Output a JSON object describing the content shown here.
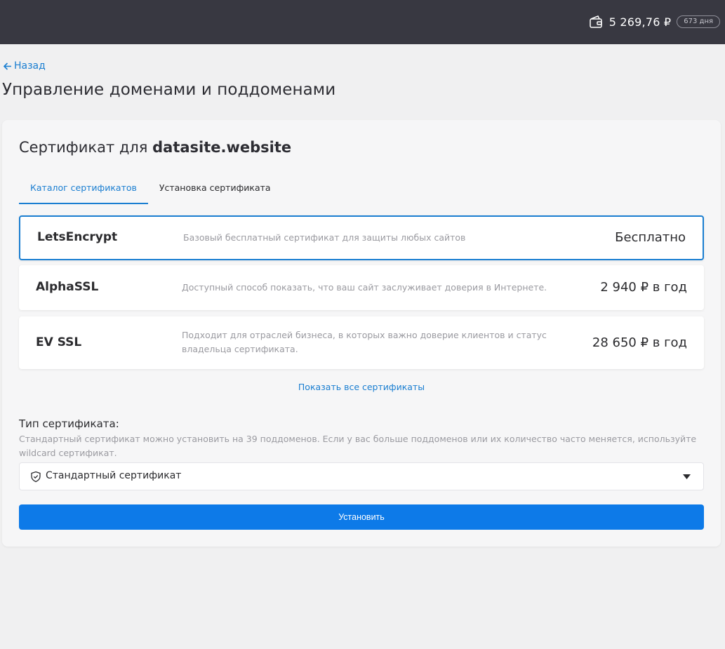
{
  "header": {
    "balance": "5 269,76 ₽",
    "days": "673 дня",
    "wallet_icon": "wallet-icon"
  },
  "nav": {
    "back_label": "Назад",
    "page_title": "Управление доменами и поддоменами"
  },
  "certificate": {
    "title_prefix": "Сертификат для",
    "domain": "datasite.website",
    "tabs": [
      {
        "label": "Каталог сертификатов",
        "active": true
      },
      {
        "label": "Установка сертификата",
        "active": false
      }
    ],
    "items": [
      {
        "name": "LetsEncrypt",
        "description": "Базовый бесплатный сертификат для защиты любых сайтов",
        "price": "Бесплатно",
        "selected": true
      },
      {
        "name": "AlphaSSL",
        "description": "Доступный способ показать, что ваш сайт заслуживает доверия в Интернете.",
        "price": "2 940 ₽ в год",
        "selected": false
      },
      {
        "name": "EV SSL",
        "description": "Подходит для отраслей бизнеса, в которых важно доверие клиентов и статус владельца сертификата.",
        "price": "28 650 ₽ в год",
        "selected": false
      }
    ],
    "show_all_label": "Показать все сертификаты",
    "type_label": "Тип сертификата:",
    "type_description": "Стандартный сертификат можно установить на 39 поддоменов. Если у вас больше поддоменов или их количество часто меняется, используйте wildcard сертификат.",
    "type_select_value": "Стандартный сертификат",
    "install_label": "Установить"
  },
  "colors": {
    "accent": "#1a7ed1",
    "button": "#0d7ae8",
    "topbar": "#383841"
  }
}
